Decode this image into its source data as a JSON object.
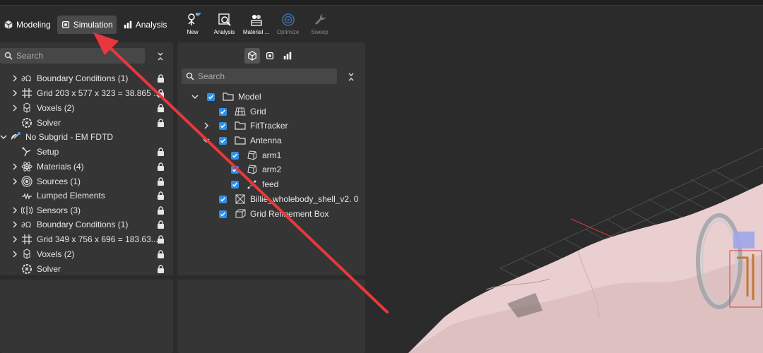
{
  "modes": [
    {
      "label": "Modeling",
      "icon": "cube-icon",
      "active": false
    },
    {
      "label": "Simulation",
      "icon": "chip-icon",
      "active": true
    },
    {
      "label": "Analysis",
      "icon": "bar-chart-icon",
      "active": false
    }
  ],
  "toolbar": {
    "new": "New",
    "analysis": "Analysis",
    "material": "Material ...",
    "optimize": "Optimize",
    "sweep": "Sweep"
  },
  "left_tree": {
    "search_placeholder": "Search",
    "items": [
      {
        "label": "Boundary Conditions (1)",
        "icon": "omega-icon"
      },
      {
        "label": "Grid 203 x 577 x 323 = 38.865 ...",
        "icon": "grid-icon"
      },
      {
        "label": "Voxels (2)",
        "icon": "voxels-icon"
      },
      {
        "label": "Solver",
        "icon": "solver-icon"
      },
      {
        "label": "No Subgrid - EM FDTD",
        "icon": "satellite-icon"
      },
      {
        "label": "Setup",
        "icon": "setup-icon"
      },
      {
        "label": "Materials (4)",
        "icon": "atom-icon"
      },
      {
        "label": "Sources (1)",
        "icon": "source-icon"
      },
      {
        "label": "Lumped Elements",
        "icon": "lumped-icon"
      },
      {
        "label": "Sensors (3)",
        "icon": "sensor-icon"
      },
      {
        "label": "Boundary Conditions (1)",
        "icon": "omega-icon"
      },
      {
        "label": "Grid 349 x 756 x 696 = 183.63...",
        "icon": "grid-icon"
      },
      {
        "label": "Voxels (2)",
        "icon": "voxels-icon"
      },
      {
        "label": "Solver",
        "icon": "solver-icon"
      }
    ]
  },
  "model_tree": {
    "search_placeholder": "Search",
    "items": [
      {
        "label": "Model",
        "icon": "folder-icon"
      },
      {
        "label": "Grid",
        "icon": "grid-icon"
      },
      {
        "label": "FitTracker",
        "icon": "folder-icon"
      },
      {
        "label": "Antenna",
        "icon": "folder-icon"
      },
      {
        "label": "arm1",
        "icon": "solid-icon"
      },
      {
        "label": "arm2",
        "icon": "solid-icon"
      },
      {
        "label": "feed",
        "icon": "wire-icon"
      },
      {
        "label": "Billie_wholebody_shell_v2. 0",
        "icon": "mesh-icon"
      },
      {
        "label": "Grid Refinement Box",
        "icon": "box-icon"
      }
    ]
  },
  "colors": {
    "accent": "#2f8fe8",
    "arrow": "#e8383d",
    "panel": "#353535",
    "background": "#2b2b2b"
  }
}
